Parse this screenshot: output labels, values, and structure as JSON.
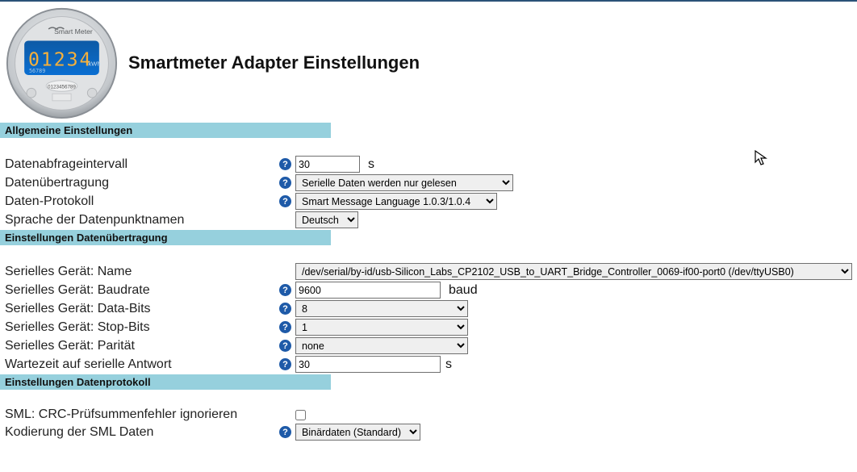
{
  "meter_face": {
    "brand": "Smart Meter",
    "readout": "01234",
    "readout_unit": "kWh",
    "small": "56789",
    "serial": "0123456789"
  },
  "page_title": "Smartmeter Adapter Einstellungen",
  "section1": {
    "title": "Allgemeine Einstellungen",
    "interval_label": "Datenabfrageintervall",
    "interval_value": "30",
    "interval_unit": "s",
    "transmission_label": "Datenübertragung",
    "transmission_value": "Serielle Daten werden nur gelesen",
    "protocol_label": "Daten-Protokoll",
    "protocol_value": "Smart Message Language 1.0.3/1.0.4",
    "lang_label": "Sprache der Datenpunktnamen",
    "lang_value": "Deutsch"
  },
  "section2": {
    "title": "Einstellungen Datenübertragung",
    "device_label": "Serielles Gerät: Name",
    "device_value": "/dev/serial/by-id/usb-Silicon_Labs_CP2102_USB_to_UART_Bridge_Controller_0069-if00-port0 (/dev/ttyUSB0)",
    "baud_label": "Serielles Gerät: Baudrate",
    "baud_value": "9600",
    "baud_unit": "baud",
    "databits_label": "Serielles Gerät: Data-Bits",
    "databits_value": "8",
    "stopbits_label": "Serielles Gerät: Stop-Bits",
    "stopbits_value": "1",
    "parity_label": "Serielles Gerät: Parität",
    "parity_value": "none",
    "wait_label": "Wartezeit auf serielle Antwort",
    "wait_value": "30",
    "wait_unit": "s"
  },
  "section3": {
    "title": "Einstellungen Datenprotokoll",
    "crc_label": "SML: CRC-Prüfsummenfehler ignorieren",
    "crc_checked": false,
    "encoding_label": "Kodierung der SML Daten",
    "encoding_value": "Binärdaten (Standard)"
  }
}
